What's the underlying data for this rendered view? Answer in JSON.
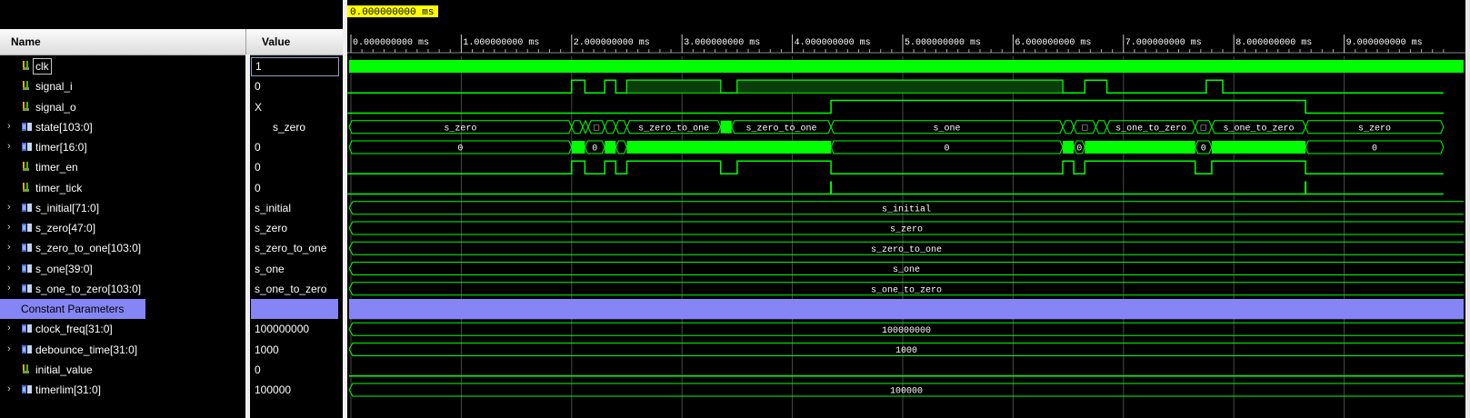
{
  "header": {
    "name_label": "Name",
    "value_label": "Value"
  },
  "cursor": {
    "time_label": "0.000000000 ms"
  },
  "timescale": {
    "ticks": [
      "0.000000000 ms",
      "1.000000000 ms",
      "2.000000000 ms",
      "3.000000000 ms",
      "4.000000000 ms",
      "5.000000000 ms",
      "6.000000000 ms",
      "7.000000000 ms",
      "8.000000000 ms",
      "9.000000000 ms"
    ]
  },
  "colors": {
    "wave": "#00ff00",
    "group": "#8585f5",
    "cursor_bg": "#ffff00",
    "grid": "#4a4a4a"
  },
  "signals": [
    {
      "name": "clk",
      "value": "1",
      "icon": "bit-signal-icon",
      "expandable": false,
      "kind": "clock"
    },
    {
      "name": "signal_i",
      "value": "0",
      "icon": "bit-signal-icon",
      "expandable": false,
      "kind": "bit"
    },
    {
      "name": "signal_o",
      "value": "X",
      "icon": "bit-signal-icon",
      "expandable": false,
      "kind": "bit"
    },
    {
      "name": "state[103:0]",
      "value": "s_zero",
      "icon": "bus-signal-icon",
      "expandable": true,
      "kind": "bus",
      "centered": true
    },
    {
      "name": "timer[16:0]",
      "value": "0",
      "icon": "bus-signal-icon",
      "expandable": true,
      "kind": "bus"
    },
    {
      "name": "timer_en",
      "value": "0",
      "icon": "bit-signal-icon",
      "expandable": false,
      "kind": "bit"
    },
    {
      "name": "timer_tick",
      "value": "0",
      "icon": "bit-signal-icon",
      "expandable": false,
      "kind": "bit"
    },
    {
      "name": "s_initial[71:0]",
      "value": "s_initial",
      "icon": "bus-signal-icon",
      "expandable": true,
      "kind": "const"
    },
    {
      "name": "s_zero[47:0]",
      "value": "s_zero",
      "icon": "bus-signal-icon",
      "expandable": true,
      "kind": "const"
    },
    {
      "name": "s_zero_to_one[103:0]",
      "value": "s_zero_to_one",
      "icon": "bus-signal-icon",
      "expandable": true,
      "kind": "const"
    },
    {
      "name": "s_one[39:0]",
      "value": "s_one",
      "icon": "bus-signal-icon",
      "expandable": true,
      "kind": "const"
    },
    {
      "name": "s_one_to_zero[103:0]",
      "value": "s_one_to_zero",
      "icon": "bus-signal-icon",
      "expandable": true,
      "kind": "const"
    },
    {
      "name": "Constant Parameters",
      "value": "",
      "icon": "",
      "expandable": false,
      "kind": "group"
    },
    {
      "name": "clock_freq[31:0]",
      "value": "100000000",
      "icon": "bus-signal-icon",
      "expandable": true,
      "kind": "const"
    },
    {
      "name": "debounce_time[31:0]",
      "value": "1000",
      "icon": "bus-signal-icon",
      "expandable": true,
      "kind": "const"
    },
    {
      "name": "initial_value",
      "value": "0",
      "icon": "bit-signal-icon",
      "expandable": false,
      "kind": "flat"
    },
    {
      "name": "timerlim[31:0]",
      "value": "100000",
      "icon": "bus-signal-icon",
      "expandable": true,
      "kind": "const"
    }
  ],
  "waves": {
    "signal_i": {
      "highs": [
        [
          2.0,
          2.12
        ],
        [
          2.3,
          2.4
        ],
        [
          2.5,
          3.35
        ],
        [
          3.5,
          6.45
        ],
        [
          6.65,
          6.85
        ],
        [
          7.75,
          7.9
        ]
      ],
      "dense": [
        [
          2.5,
          3.35
        ],
        [
          3.5,
          6.45
        ]
      ]
    },
    "signal_o": {
      "highs": [
        [
          4.35,
          8.65
        ]
      ]
    },
    "timer_en": {
      "highs": [
        [
          2.0,
          2.12
        ],
        [
          2.3,
          2.4
        ],
        [
          2.5,
          3.35
        ],
        [
          3.5,
          4.35
        ],
        [
          6.45,
          6.55
        ],
        [
          6.65,
          7.65
        ],
        [
          7.8,
          8.65
        ]
      ]
    },
    "timer_tick": {
      "pulses": [
        4.35,
        8.65
      ]
    },
    "state": [
      {
        "from": -0.2,
        "to": 2.0,
        "label": "s_zero"
      },
      {
        "from": 2.0,
        "to": 2.1,
        "label": ""
      },
      {
        "from": 2.1,
        "to": 2.15,
        "label": ""
      },
      {
        "from": 2.15,
        "to": 2.3,
        "label": "□"
      },
      {
        "from": 2.3,
        "to": 2.4,
        "label": ""
      },
      {
        "from": 2.4,
        "to": 2.5,
        "label": ""
      },
      {
        "from": 2.5,
        "to": 3.35,
        "label": "s_zero_to_one"
      },
      {
        "from": 3.35,
        "to": 3.45,
        "label": "",
        "fill": true
      },
      {
        "from": 3.45,
        "to": 4.35,
        "label": "s_zero_to_one"
      },
      {
        "from": 4.35,
        "to": 6.45,
        "label": "s_one"
      },
      {
        "from": 6.45,
        "to": 6.55,
        "label": ""
      },
      {
        "from": 6.55,
        "to": 6.75,
        "label": "□"
      },
      {
        "from": 6.75,
        "to": 6.85,
        "label": ""
      },
      {
        "from": 6.85,
        "to": 7.65,
        "label": "s_one_to_zero"
      },
      {
        "from": 7.65,
        "to": 7.8,
        "label": "□"
      },
      {
        "from": 7.8,
        "to": 8.65,
        "label": "s_one_to_zero"
      },
      {
        "from": 8.65,
        "to": 9.9,
        "label": "s_zero"
      }
    ],
    "timer": [
      {
        "from": -0.2,
        "to": 2.0,
        "label": "0"
      },
      {
        "from": 2.0,
        "to": 2.12,
        "label": "",
        "fill": true
      },
      {
        "from": 2.12,
        "to": 2.3,
        "label": "0"
      },
      {
        "from": 2.3,
        "to": 2.4,
        "label": "",
        "fill": true
      },
      {
        "from": 2.4,
        "to": 2.5,
        "label": ""
      },
      {
        "from": 2.5,
        "to": 4.35,
        "label": "",
        "fill": true
      },
      {
        "from": 4.35,
        "to": 6.45,
        "label": "0"
      },
      {
        "from": 6.45,
        "to": 6.55,
        "label": "",
        "fill": true
      },
      {
        "from": 6.55,
        "to": 6.65,
        "label": "0"
      },
      {
        "from": 6.65,
        "to": 7.65,
        "label": "",
        "fill": true
      },
      {
        "from": 7.65,
        "to": 7.8,
        "label": "0"
      },
      {
        "from": 7.8,
        "to": 8.65,
        "label": "",
        "fill": true
      },
      {
        "from": 8.65,
        "to": 9.9,
        "label": "0"
      }
    ]
  }
}
